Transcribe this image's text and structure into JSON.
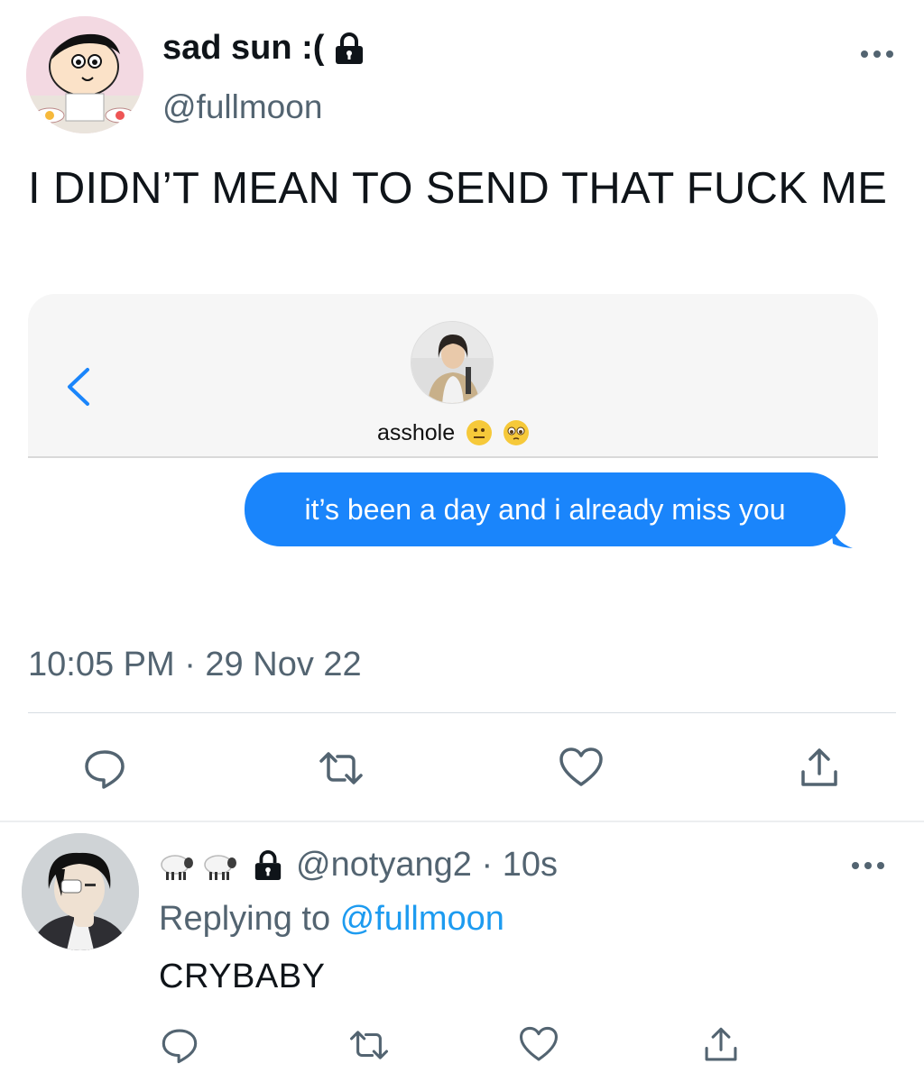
{
  "main_tweet": {
    "display_name": "sad sun :(",
    "handle": "@fullmoon",
    "text": "I DIDN’T MEAN TO SEND THAT FUCK ME",
    "timestamp": "10:05 PM · 29 Nov 22",
    "embedded_screenshot": {
      "contact_name": "asshole",
      "message": "it’s been a day and i already miss you"
    }
  },
  "reply_tweet": {
    "handle_time": "@notyang2 · 10s",
    "replying_prefix": "Replying to ",
    "replying_mention": "@fullmoon",
    "text": "CRYBABY"
  },
  "icons": {
    "lock": "lock-icon",
    "more": "more-horizontal-icon",
    "reply": "reply-bubble-icon",
    "retweet": "retweet-icon",
    "like": "heart-icon",
    "share": "share-upload-icon",
    "back": "chevron-left-icon",
    "sheep": "sheep-emoji-icon"
  },
  "colors": {
    "text_primary": "#0f1419",
    "text_secondary": "#536471",
    "link": "#1d9bf0",
    "imessage_blue": "#1a85fb"
  }
}
